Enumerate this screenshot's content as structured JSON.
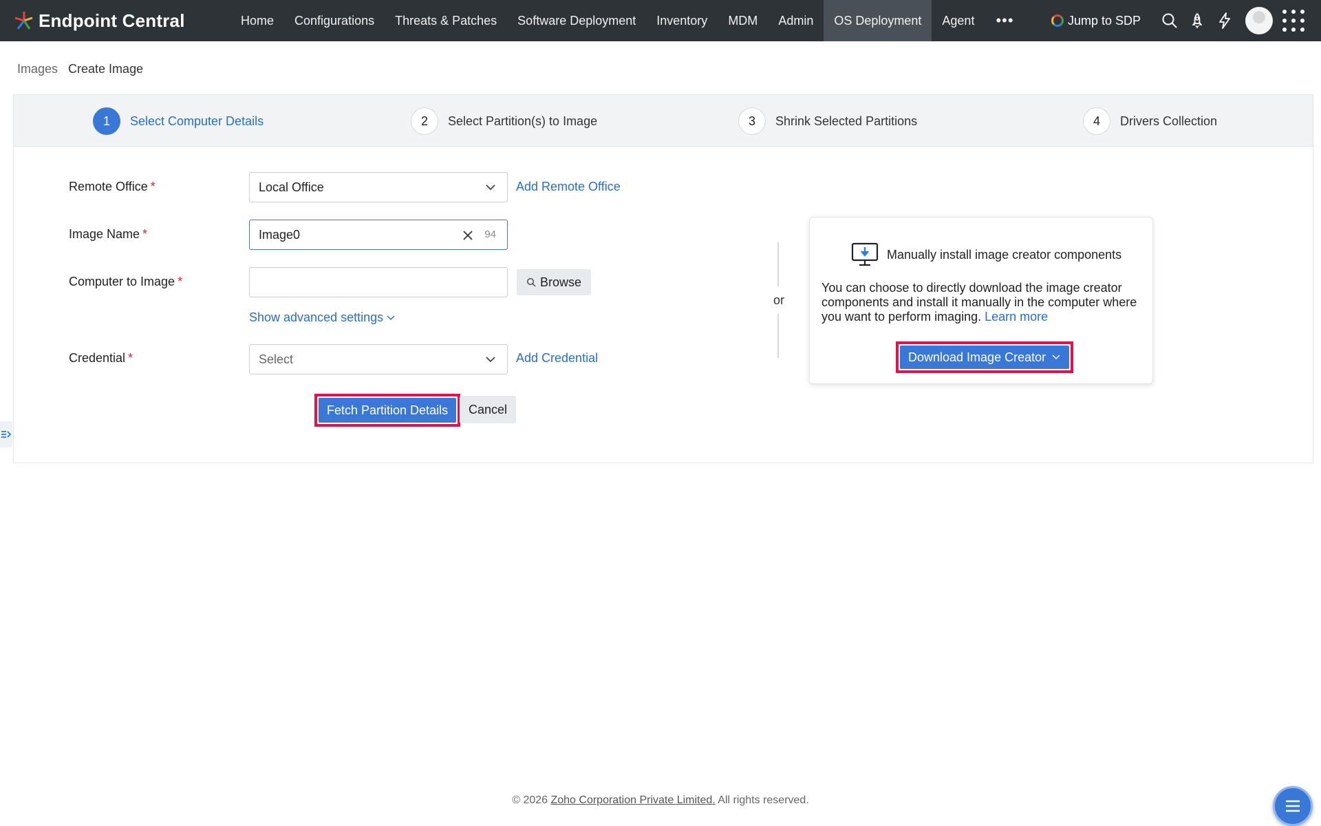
{
  "app": {
    "name": "Endpoint Central"
  },
  "nav": {
    "items": [
      "Home",
      "Configurations",
      "Threats & Patches",
      "Software Deployment",
      "Inventory",
      "MDM",
      "Admin",
      "OS Deployment",
      "Agent"
    ],
    "active": "OS Deployment",
    "more": "•••"
  },
  "tools": {
    "jump_label": "Jump to SDP"
  },
  "breadcrumb": {
    "parent": "Images",
    "current": "Create Image"
  },
  "steps": [
    {
      "num": "1",
      "label": "Select Computer Details"
    },
    {
      "num": "2",
      "label": "Select Partition(s) to Image"
    },
    {
      "num": "3",
      "label": "Shrink Selected Partitions"
    },
    {
      "num": "4",
      "label": "Drivers Collection"
    }
  ],
  "form": {
    "remote_office": {
      "label": "Remote Office",
      "value": "Local Office",
      "link": "Add Remote Office"
    },
    "image_name": {
      "label": "Image Name",
      "value": "Image0",
      "remaining": "94"
    },
    "computer": {
      "label": "Computer to Image",
      "value": "",
      "browse": "Browse"
    },
    "advanced": "Show advanced settings",
    "credential": {
      "label": "Credential",
      "placeholder": "Select",
      "link": "Add Credential"
    },
    "required_mark": "*",
    "fetch_button": "Fetch Partition Details",
    "cancel_button": "Cancel"
  },
  "or_label": "or",
  "manual": {
    "title": "Manually install image creator components",
    "text": "You can choose to directly download the image creator components and install it manually in the computer where you want to perform imaging.",
    "learn_more": "Learn more",
    "download_button": "Download Image Creator"
  },
  "footer": {
    "prefix": "© 2026",
    "org": "Zoho Corporation Private Limited.",
    "suffix": "All rights reserved."
  },
  "colors": {
    "primary": "#3a78d8",
    "highlight": "#e3124d",
    "topbar": "#2e3338",
    "link": "#2a6ec5"
  }
}
